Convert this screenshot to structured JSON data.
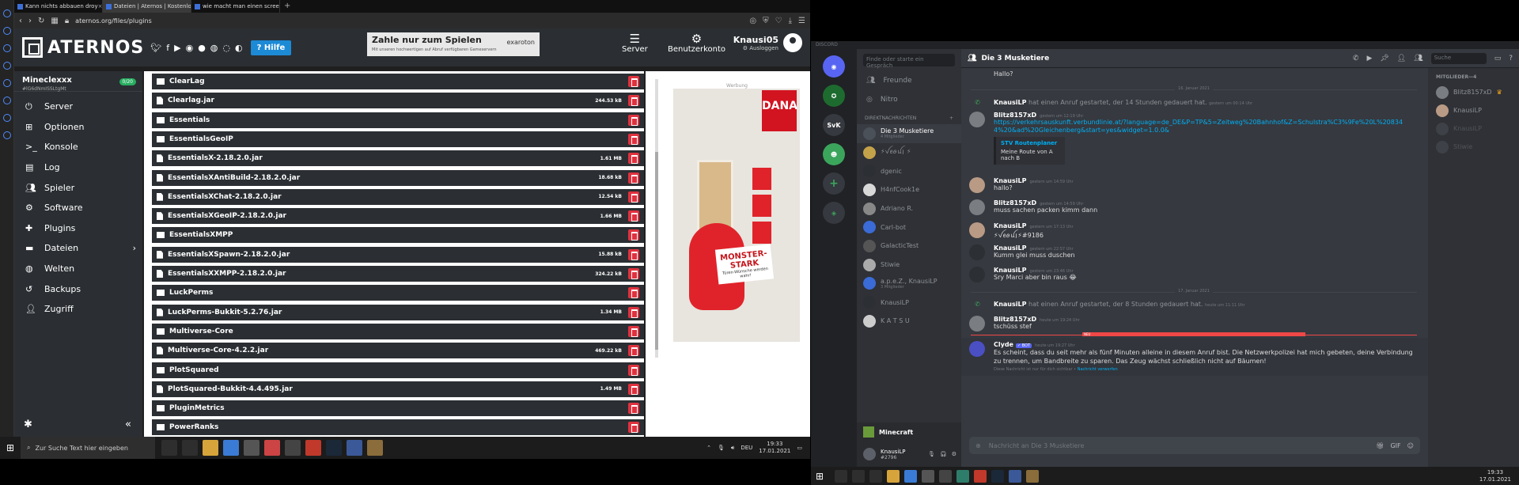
{
  "browser": {
    "tabs": [
      {
        "title": "Kann nichts abbauen droy"
      },
      {
        "title": "Dateien | Aternos | Kostenlo"
      },
      {
        "title": "wie macht man einen scree"
      }
    ],
    "url": "aternos.org/files/plugins"
  },
  "aternos": {
    "logo": "ATERNOS",
    "help": "Hilfe",
    "banner_title": "Zahle nur zum Spielen",
    "banner_sub": "Mit unseren hochwertigen auf Abruf verfügbaren Gameservern",
    "banner_brand": "exaroton",
    "nav_server": "Server",
    "nav_account": "Benutzerkonto",
    "username": "Knausi05",
    "logout": "Ausloggen",
    "server_name": "Mineclexxx",
    "server_id": "#lG6dNmISSLtgMt",
    "server_badge": "0/20",
    "menu": [
      "Server",
      "Optionen",
      "Konsole",
      "Log",
      "Spieler",
      "Software",
      "Plugins",
      "Dateien",
      "Welten",
      "Backups",
      "Zugriff"
    ],
    "files": [
      {
        "name": "ClearLag",
        "size": "",
        "type": "dir"
      },
      {
        "name": "Clearlag.jar",
        "size": "244.53 kB",
        "type": "file"
      },
      {
        "name": "Essentials",
        "size": "",
        "type": "dir"
      },
      {
        "name": "EssentialsGeoIP",
        "size": "",
        "type": "dir"
      },
      {
        "name": "EssentialsX-2.18.2.0.jar",
        "size": "1.61 MB",
        "type": "file"
      },
      {
        "name": "EssentialsXAntiBuild-2.18.2.0.jar",
        "size": "18.68 kB",
        "type": "file"
      },
      {
        "name": "EssentialsXChat-2.18.2.0.jar",
        "size": "12.54 kB",
        "type": "file"
      },
      {
        "name": "EssentialsXGeoIP-2.18.2.0.jar",
        "size": "1.66 MB",
        "type": "file"
      },
      {
        "name": "EssentialsXMPP",
        "size": "",
        "type": "dir"
      },
      {
        "name": "EssentialsXSpawn-2.18.2.0.jar",
        "size": "15.88 kB",
        "type": "file"
      },
      {
        "name": "EssentialsXXMPP-2.18.2.0.jar",
        "size": "324.22 kB",
        "type": "file"
      },
      {
        "name": "LuckPerms",
        "size": "",
        "type": "dir"
      },
      {
        "name": "LuckPerms-Bukkit-5.2.76.jar",
        "size": "1.34 MB",
        "type": "file"
      },
      {
        "name": "Multiverse-Core",
        "size": "",
        "type": "dir"
      },
      {
        "name": "Multiverse-Core-4.2.2.jar",
        "size": "469.22 kB",
        "type": "file"
      },
      {
        "name": "PlotSquared",
        "size": "",
        "type": "dir"
      },
      {
        "name": "PlotSquared-Bukkit-4.4.495.jar",
        "size": "1.49 MB",
        "type": "file"
      },
      {
        "name": "PluginMetrics",
        "size": "",
        "type": "dir"
      },
      {
        "name": "PowerRanks",
        "size": "",
        "type": "dir"
      }
    ],
    "ad_label": "Werbung",
    "ad_brand": "DANA",
    "ad_sign": "MONSTER-STARK",
    "ad_sign_sub": "Türen-Wünsche werden wahr!"
  },
  "taskbar_left": {
    "search": "Zur Suche Text hier eingeben",
    "lang": "DEU",
    "time": "19:33",
    "date": "17.01.2021"
  },
  "discord": {
    "title": "DISCORD",
    "search": "Finde oder starte ein Gespräch",
    "friends": "Freunde",
    "nitro": "Nitro",
    "dm_header": "DIREKTNACHRICHTEN",
    "guild_svk": "SvK",
    "dms": [
      {
        "name": "Die 3 Musketiere",
        "sub": "4 Mitglieder"
      },
      {
        "name": "⚡︎ꪜꫀꪮꪊ꩝ ⚡︎",
        "sub": ""
      },
      {
        "name": "dgenic",
        "sub": ""
      },
      {
        "name": "H4nfCook1e",
        "sub": ""
      },
      {
        "name": "Adriano R.",
        "sub": ""
      },
      {
        "name": "Carl-bot",
        "sub": ""
      },
      {
        "name": "GalacticTest",
        "sub": ""
      },
      {
        "name": "Stiwie",
        "sub": ""
      },
      {
        "name": "a.p.e.Z., KnausiLP",
        "sub": "3 Mitglieder"
      },
      {
        "name": "KnausiLP",
        "sub": ""
      },
      {
        "name": "K A T S U",
        "sub": ""
      }
    ],
    "voice": "Minecraft",
    "user_name": "KnausiLP",
    "user_tag": "#2796",
    "channel": "Die 3 Musketiere",
    "chat_search": "Suche",
    "msg_hallo": "Hallo?",
    "date1": "16. Januar 2021",
    "call1_user": "KnausiLP",
    "call1_text": "hat einen Anruf gestartet, der 14 Stunden gedauert hat.",
    "call1_ts": "gestern um 00:14 Uhr",
    "m1_author": "Blitz8157xD",
    "m1_ts": "gestern um 12:19 Uhr",
    "m1_link": "https://verkehrsauskunft.verbundlinie.at/?language=de_DE&P=TP&5=Zeitweg%20Bahnhof&Z=Schulstra%C3%9Fe%20L%208344%20&ad%20Gleichenberg&start=yes&widget=1.0.0&",
    "embed_title": "STV Routenplaner",
    "embed_desc": "Meine Route von A nach B",
    "m2_author": "KnausiLP",
    "m2_ts": "gestern um 14:59 Uhr",
    "m2_text": "hallo?",
    "m3_author": "Blitz8157xD",
    "m3_ts": "gestern um 14:59 Uhr",
    "m3_text": "muss sachen packen kimm dann",
    "m4_author": "KnausiLP",
    "m4_ts": "gestern um 17:13 Uhr",
    "m4_text": "⚡︎ꪜꫀꪮꪊ꩝⚡︎#9186",
    "m5_author": "KnausiLP",
    "m5_ts": "gestern um 22:57 Uhr",
    "m5_text": "Kumm glei muss duschen",
    "m6_author": "KnausiLP",
    "m6_ts": "gestern um 23:46 Uhr",
    "m6_text": "Sry Marci aber bin raus 😂",
    "date2": "17. Januar 2021",
    "call2_user": "KnausiLP",
    "call2_text": "hat einen Anruf gestartet, der 8 Stunden gedauert hat.",
    "call2_ts": "heute um 11:11 Uhr",
    "m7_author": "Blitz8157xD",
    "m7_ts": "heute um 19:24 Uhr",
    "m7_text": "tschüss stef",
    "new_label": "NEU",
    "clyde_author": "Clyde",
    "clyde_bot": "✓ BOT",
    "clyde_ts": "heute um 19:27 Uhr",
    "clyde_text": "Es scheint, dass du seit mehr als fünf Minuten alleine in diesem Anruf bist. Die Netzwerkpolizei hat mich gebeten, deine Verbindung zu trennen, um Bandbreite zu sparen. Das Zeug wächst schließlich nicht auf Bäumen!",
    "clyde_note": "Diese Nachricht ist nur für dich sichtbar •",
    "clyde_note_link": "Nachricht verwerfen",
    "input_placeholder": "Nachricht an Die 3 Musketiere",
    "members_header": "MITGLIEDER—4",
    "members": [
      "Blitz8157xD",
      "KnausiLP",
      "KnausiLP",
      "Stiwie"
    ]
  },
  "taskbar_right": {
    "time": "19:33",
    "date": "17.01.2021"
  }
}
